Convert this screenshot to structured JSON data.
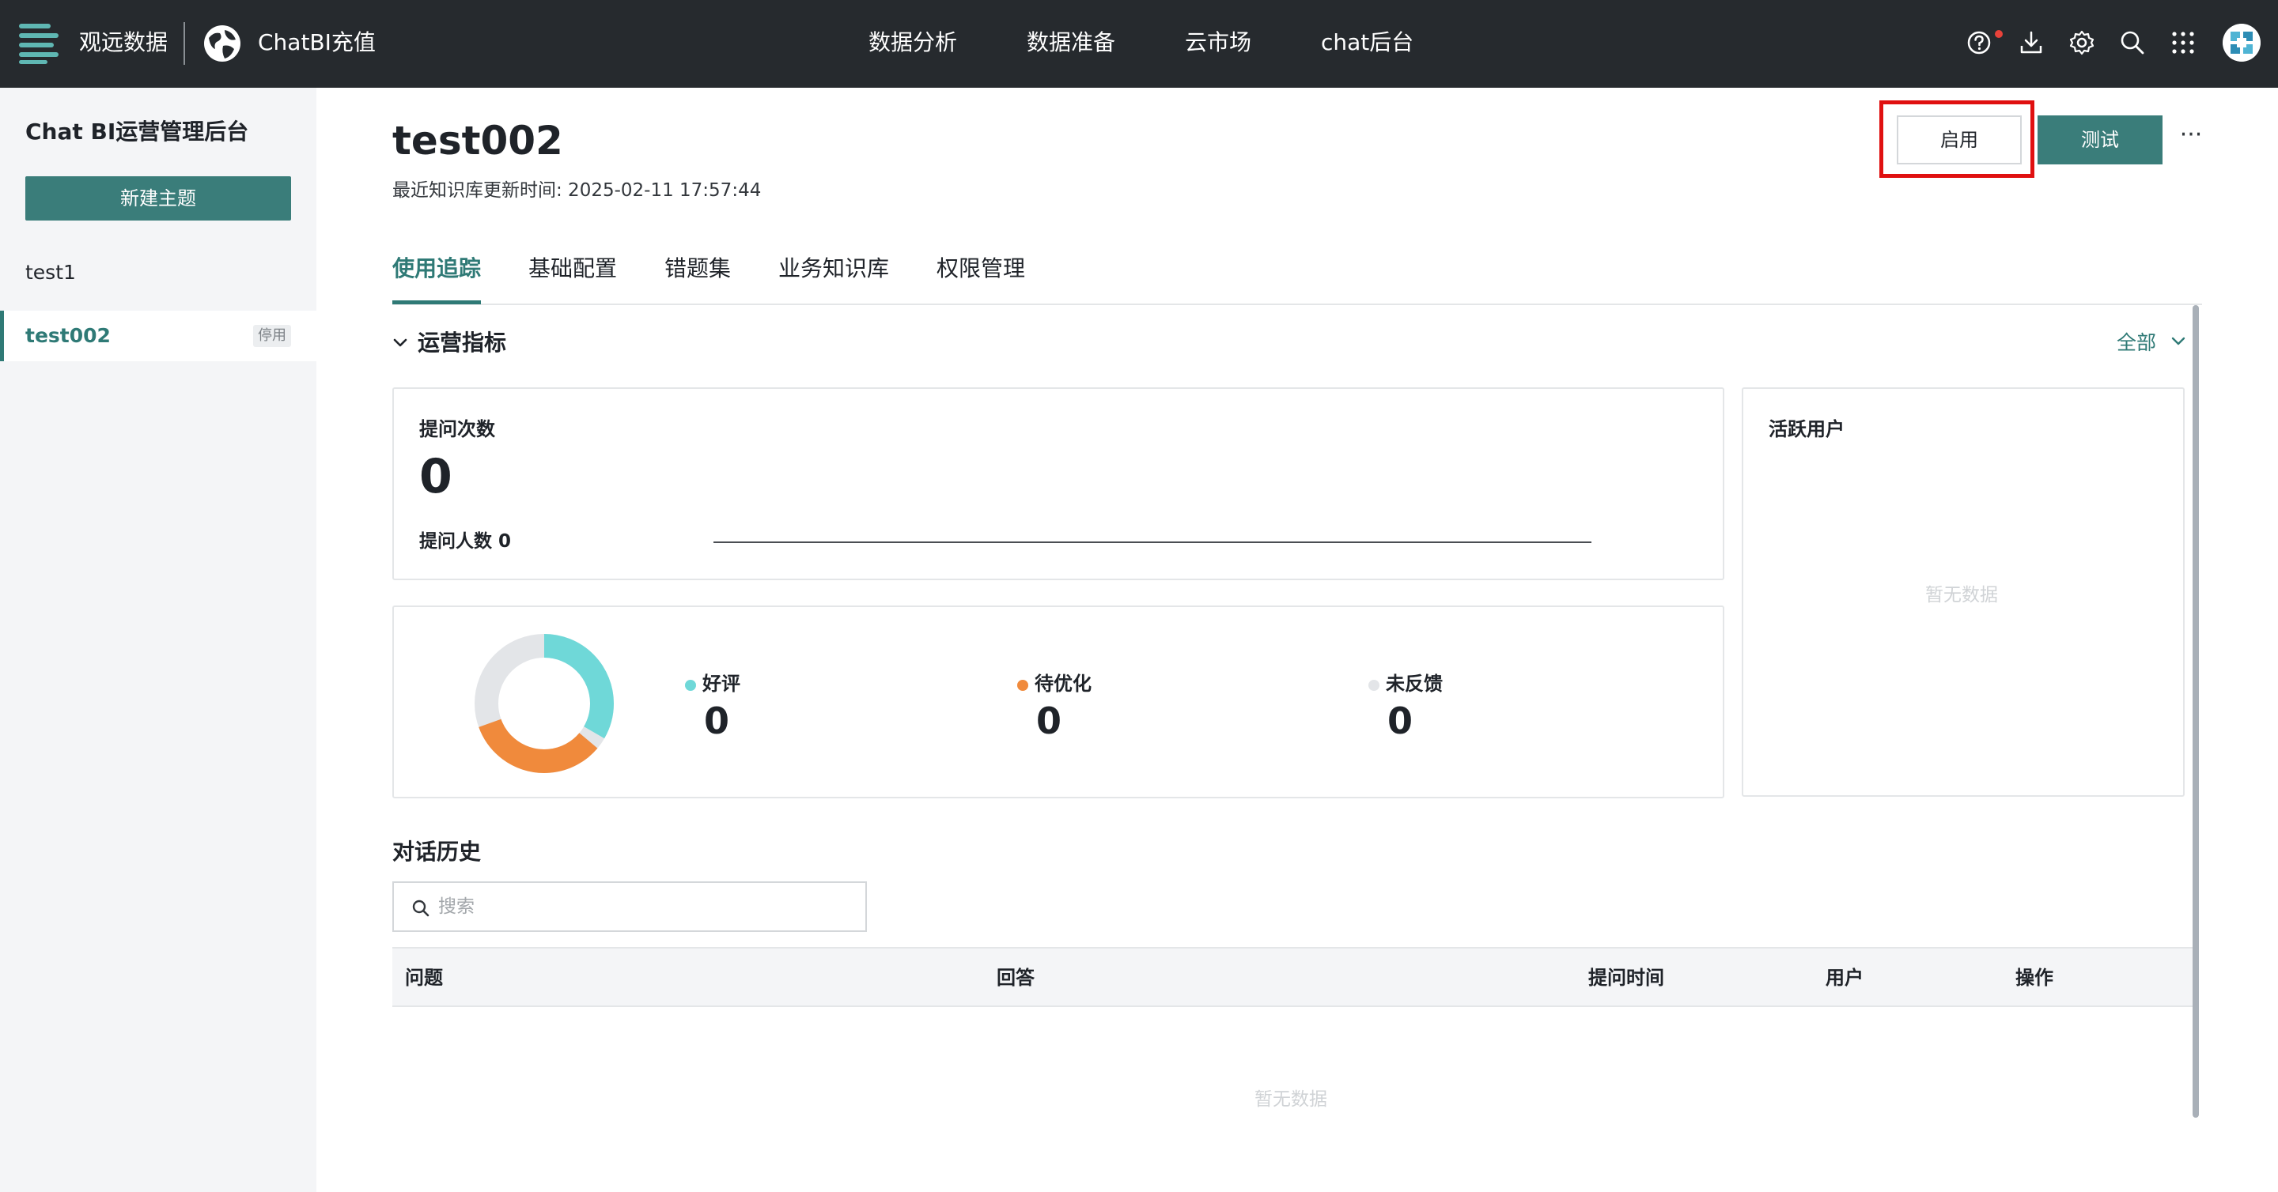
{
  "topbar": {
    "brand": "观远数据",
    "app_name": "ChatBI充值",
    "nav": [
      "数据分析",
      "数据准备",
      "云市场",
      "chat后台"
    ],
    "icons": [
      "help-icon",
      "download-icon",
      "gear-icon",
      "search-icon",
      "apps-grid-icon"
    ]
  },
  "sidebar": {
    "title": "Chat BI运营管理后台",
    "new_button": "新建主题",
    "items": [
      {
        "label": "test1",
        "badge": ""
      },
      {
        "label": "test002",
        "badge": "停用"
      }
    ]
  },
  "header": {
    "title": "test002",
    "update_time": "最近知识库更新时间:   2025-02-11 17:57:44",
    "enable_button": "启用",
    "test_button": "测试",
    "more": "···"
  },
  "tabs": [
    "使用追踪",
    "基础配置",
    "错题集",
    "业务知识库",
    "权限管理"
  ],
  "metrics": {
    "section_title": "运营指标",
    "filter": "全部",
    "questions_label": "提问次数",
    "questions_value": "0",
    "askers_label": "提问人数 0",
    "active_users_label": "活跃用户",
    "active_users_empty": "暂无数据"
  },
  "feedback": {
    "items": [
      {
        "label": "好评",
        "value": "0",
        "color": "#6fd8d8"
      },
      {
        "label": "待优化",
        "value": "0",
        "color": "#f08a3c"
      },
      {
        "label": "未反馈",
        "value": "0",
        "color": "#e3e5e8"
      }
    ]
  },
  "history": {
    "title": "对话历史",
    "search_placeholder": "搜索",
    "columns": [
      "问题",
      "回答",
      "提问时间",
      "用户",
      "操作"
    ],
    "empty": "暂无数据"
  },
  "colors": {
    "accent": "#3a7d7a",
    "topbar": "#262a2e",
    "highlight": "#e01010"
  }
}
